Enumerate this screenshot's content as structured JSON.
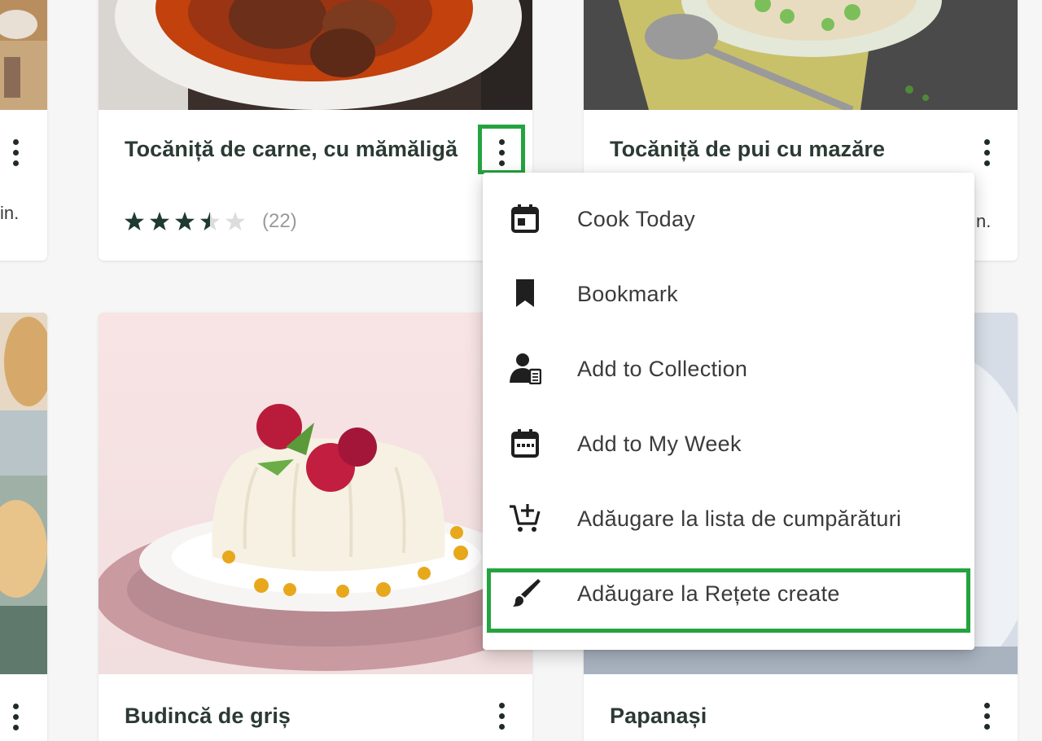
{
  "recipes": [
    {
      "title": "Tocăniță de carne, cu mămăligă",
      "rating": 3.5,
      "rating_count": "(22)"
    },
    {
      "title": "Tocăniță de pui cu mazăre",
      "meta_right": "n."
    },
    {
      "title": "Budincă de griș"
    },
    {
      "title": "Papanași"
    }
  ],
  "left_partial_meta": "in.",
  "context_menu": {
    "items": [
      {
        "label": "Cook Today",
        "icon": "calendar-today-icon"
      },
      {
        "label": "Bookmark",
        "icon": "bookmark-icon"
      },
      {
        "label": "Add to Collection",
        "icon": "collection-user-icon"
      },
      {
        "label": "Add to My Week",
        "icon": "calendar-week-icon"
      },
      {
        "label": "Adăugare la lista de cumpărături",
        "icon": "cart-add-icon"
      },
      {
        "label": "Adăugare la Rețete create",
        "icon": "brush-icon"
      }
    ],
    "highlighted_item": "Adăugare la Rețete create"
  },
  "colors": {
    "highlight": "#24a33f",
    "title_text": "#2b3a33",
    "menu_text": "#3b3b3b",
    "star_filled": "#1f3a30",
    "star_empty": "#dcdcdc"
  }
}
